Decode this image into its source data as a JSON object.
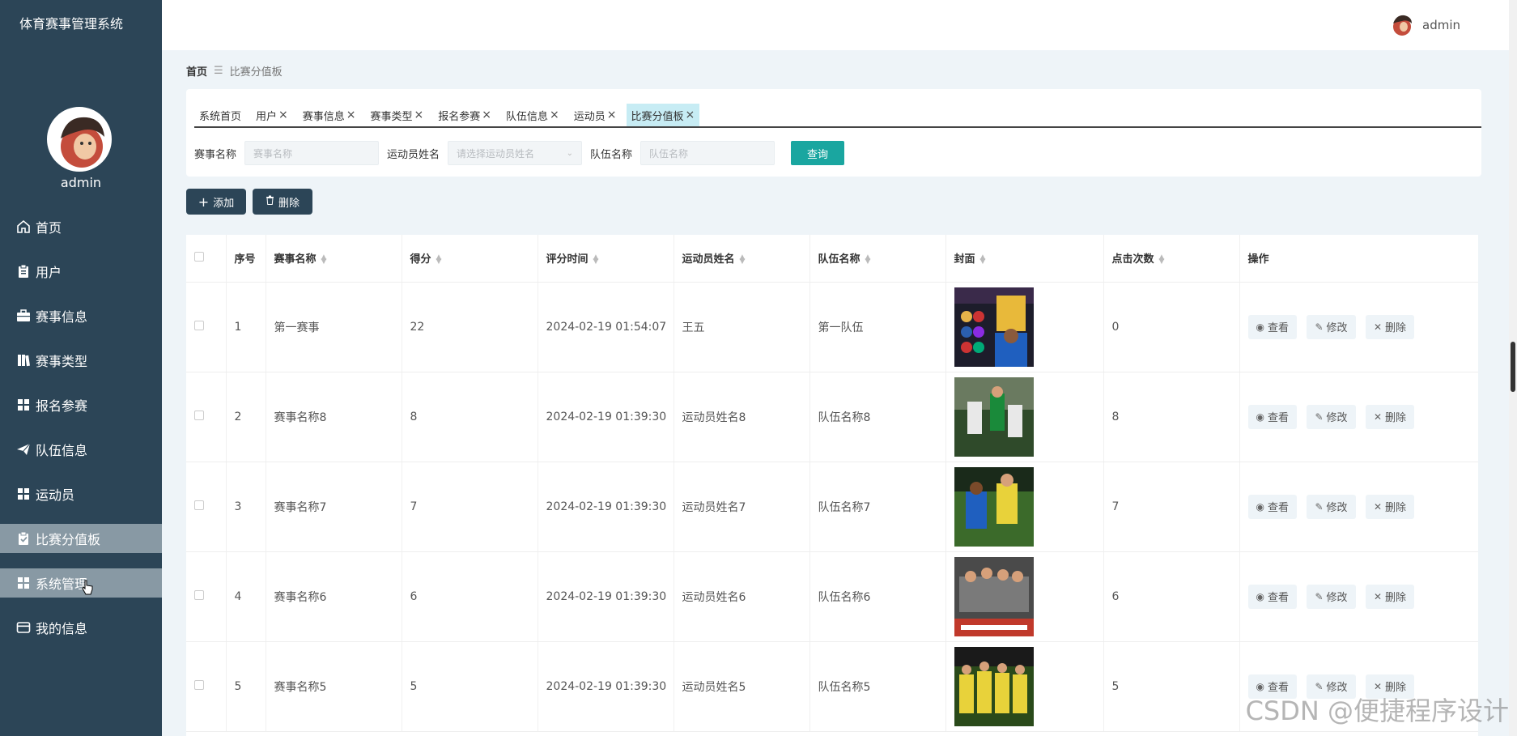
{
  "app": {
    "title": "体育赛事管理系统"
  },
  "user": {
    "name": "admin"
  },
  "sidebar": {
    "items": [
      {
        "label": "首页",
        "icon": "home-icon"
      },
      {
        "label": "用户",
        "icon": "clipboard-icon"
      },
      {
        "label": "赛事信息",
        "icon": "briefcase-icon"
      },
      {
        "label": "赛事类型",
        "icon": "books-icon"
      },
      {
        "label": "报名参赛",
        "icon": "grid-icon"
      },
      {
        "label": "队伍信息",
        "icon": "paper-plane-icon"
      },
      {
        "label": "运动员",
        "icon": "grid-icon"
      },
      {
        "label": "比赛分值板",
        "icon": "clipboard-check-icon"
      },
      {
        "label": "系统管理",
        "icon": "grid-icon"
      },
      {
        "label": "我的信息",
        "icon": "card-icon"
      }
    ]
  },
  "breadcrumb": {
    "home": "首页",
    "current": "比赛分值板"
  },
  "tabs": [
    "系统首页",
    "用户",
    "赛事信息",
    "赛事类型",
    "报名参赛",
    "队伍信息",
    "运动员",
    "比赛分值板"
  ],
  "search": {
    "match_label": "赛事名称",
    "match_placeholder": "赛事名称",
    "athlete_label": "运动员姓名",
    "athlete_placeholder": "请选择运动员姓名",
    "team_label": "队伍名称",
    "team_placeholder": "队伍名称",
    "query_label": "查询"
  },
  "actions": {
    "add_label": "添加",
    "delete_label": "删除"
  },
  "table": {
    "headers": [
      "序号",
      "赛事名称",
      "得分",
      "评分时间",
      "运动员姓名",
      "队伍名称",
      "封面",
      "点击次数",
      "操作"
    ],
    "ops": {
      "view": "查看",
      "edit": "修改",
      "delete": "删除"
    },
    "rows": [
      {
        "index": "1",
        "match": "第一赛事",
        "score": "22",
        "time": "2024-02-19 01:54:07",
        "athlete": "王五",
        "team": "第一队伍",
        "clicks": "0"
      },
      {
        "index": "2",
        "match": "赛事名称8",
        "score": "8",
        "time": "2024-02-19 01:39:30",
        "athlete": "运动员姓名8",
        "team": "队伍名称8",
        "clicks": "8"
      },
      {
        "index": "3",
        "match": "赛事名称7",
        "score": "7",
        "time": "2024-02-19 01:39:30",
        "athlete": "运动员姓名7",
        "team": "队伍名称7",
        "clicks": "7"
      },
      {
        "index": "4",
        "match": "赛事名称6",
        "score": "6",
        "time": "2024-02-19 01:39:30",
        "athlete": "运动员姓名6",
        "team": "队伍名称6",
        "clicks": "6"
      },
      {
        "index": "5",
        "match": "赛事名称5",
        "score": "5",
        "time": "2024-02-19 01:39:30",
        "athlete": "运动员姓名5",
        "team": "队伍名称5",
        "clicks": "5"
      }
    ]
  },
  "watermark": "CSDN @便捷程序设计",
  "colors": {
    "sidebar": "#2c4557",
    "accent": "#1aa6a0",
    "active_tab": "#c7ecf4"
  }
}
